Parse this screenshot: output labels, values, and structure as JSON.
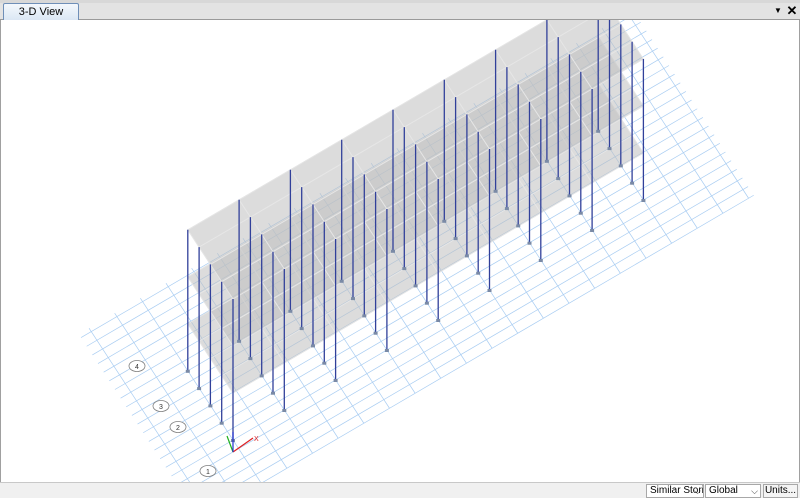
{
  "window": {
    "tab_label": "3-D View",
    "pin_glyph": "▼",
    "close_glyph": "✕"
  },
  "view": {
    "grid_bubbles": [
      "4",
      "3",
      "2",
      "1"
    ],
    "axes": {
      "x_label": "X"
    }
  },
  "status": {
    "story_selection": "Similar Stories",
    "coordinate_system": "Global",
    "units_button": "Units..."
  },
  "colors": {
    "grid_line": "#a9cdf2",
    "column": "#31409a",
    "slab": "#bfbfbf",
    "axis_x": "#e02020",
    "axis_y": "#20b020",
    "axis_z": "#2030d0"
  }
}
